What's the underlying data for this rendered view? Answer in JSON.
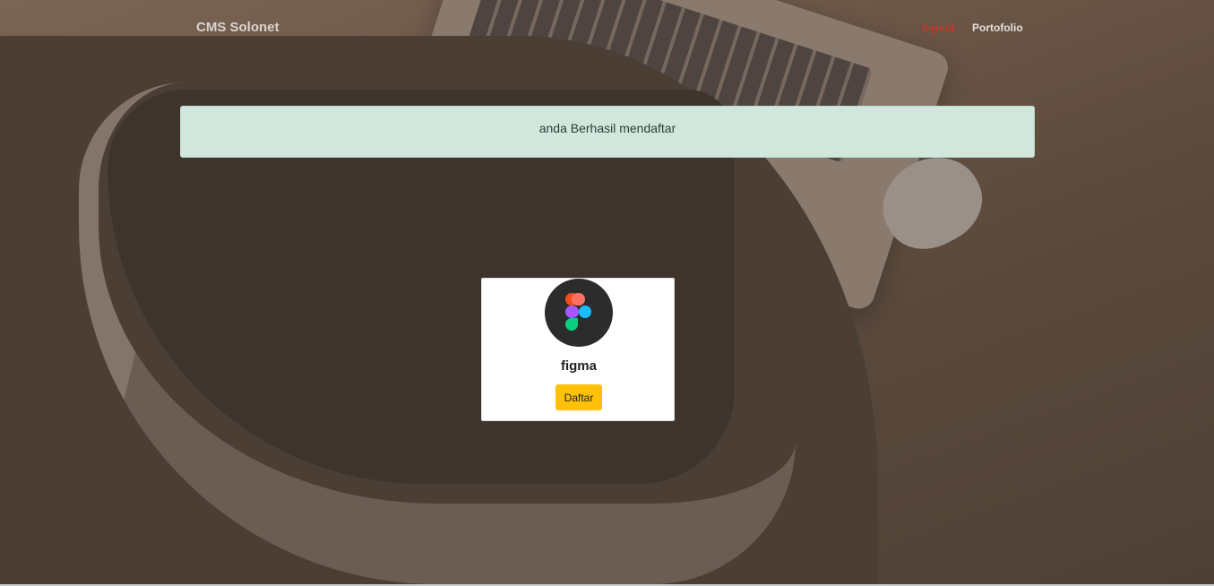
{
  "navbar": {
    "brand": "CMS Solonet",
    "links": [
      {
        "label": "logout",
        "color": "#c0392b"
      },
      {
        "label": "Portofolio"
      }
    ]
  },
  "alert": {
    "message": "anda Berhasil mendaftar",
    "background": "#d1e7dd"
  },
  "card": {
    "logo_icon": "figma-logo-icon",
    "title": "figma",
    "button_label": "Daftar",
    "button_color": "#ffc107"
  }
}
